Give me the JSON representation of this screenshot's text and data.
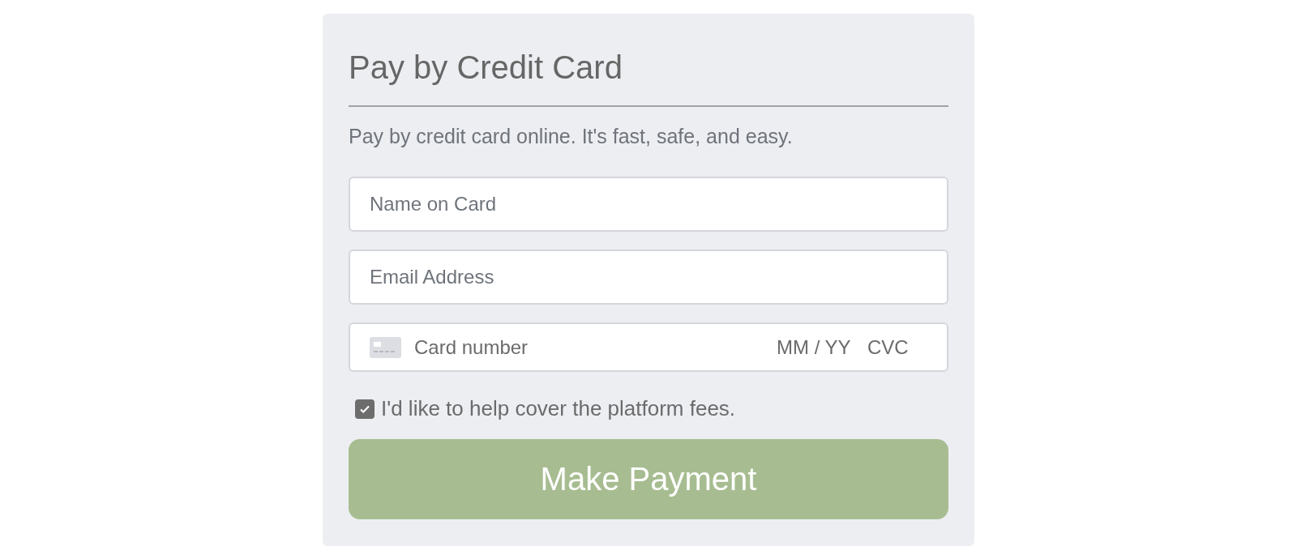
{
  "form": {
    "title": "Pay by Credit Card",
    "description": "Pay by credit card online. It's fast, safe, and easy.",
    "fields": [
      {
        "placeholder": "Name on Card"
      },
      {
        "placeholder": "Email Address"
      }
    ],
    "card_field": {
      "number_placeholder": "Card number",
      "expiry_placeholder": "MM / YY",
      "cvc_placeholder": "CVC"
    },
    "consent": {
      "label": "I'd like to help cover the platform fees.",
      "checked": true
    },
    "submit": "Make Payment"
  }
}
